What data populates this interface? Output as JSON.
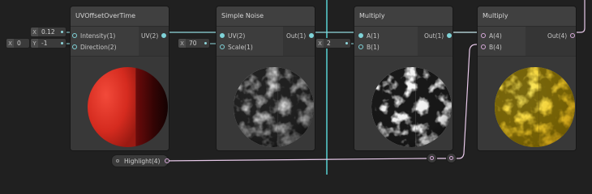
{
  "colors": {
    "canvas_bg": "#202020",
    "uv_wire": "#8fd8dd",
    "vector4_wire": "#e7c9e9",
    "selection_line": "#54c7c9"
  },
  "nodes": {
    "uv_offset": {
      "title": "UVOffsetOverTime",
      "inputs": [
        "Intensity(1)",
        "Direction(2)"
      ],
      "outputs": [
        "UV(2)"
      ],
      "preview": "red-sphere"
    },
    "simple_noise": {
      "title": "Simple Noise",
      "inputs": [
        "UV(2)",
        "Scale(1)"
      ],
      "outputs": [
        "Out(1)"
      ],
      "preview": "noise-sphere"
    },
    "multiply_1": {
      "title": "Multiply",
      "inputs": [
        "A(1)",
        "B(1)"
      ],
      "outputs": [
        "Out(1)"
      ],
      "preview": "white-noise-sphere"
    },
    "multiply_2": {
      "title": "Multiply",
      "inputs": [
        "A(4)",
        "B(4)"
      ],
      "outputs": [
        "Out(4)"
      ],
      "preview": "yellow-noise-sphere"
    }
  },
  "inline_fields": {
    "intensity": {
      "axis": "X",
      "value": "0.12"
    },
    "direction_x": {
      "axis": "X",
      "value": "0"
    },
    "direction_y": {
      "axis": "Y",
      "value": "-1"
    },
    "scale": {
      "axis": "X",
      "value": "70"
    },
    "multiply_b": {
      "axis": "X",
      "value": "2"
    }
  },
  "property_chip": {
    "label": "Highlight(4)"
  }
}
